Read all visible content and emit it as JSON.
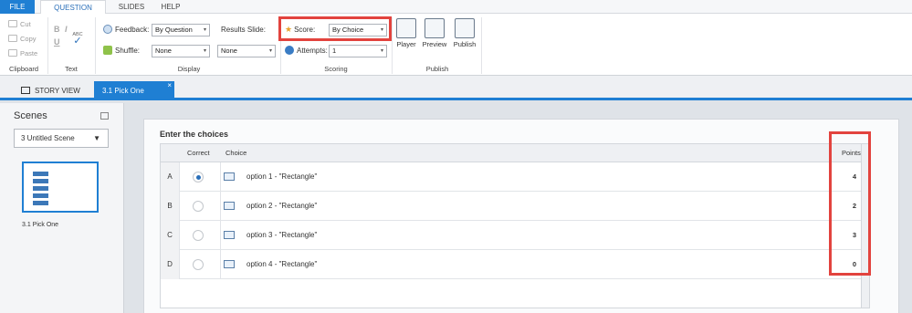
{
  "ribbon_tabs": [
    "FILE",
    "QUESTION",
    "SLIDES",
    "HELP"
  ],
  "clipboard": {
    "cut": "Cut",
    "copy": "Copy",
    "paste": "Paste",
    "group": "Clipboard"
  },
  "text_group": {
    "bold": "B",
    "italic": "I",
    "underline": "U",
    "spell": "ABC",
    "group": "Text"
  },
  "display": {
    "feedback_label": "Feedback:",
    "feedback_value": "By Question",
    "shuffle_label": "Shuffle:",
    "shuffle_value": "None",
    "results_label": "Results Slide:",
    "results_value": "None",
    "group": "Display"
  },
  "scoring": {
    "score_label": "Score:",
    "score_value": "By Choice",
    "attempts_label": "Attempts:",
    "attempts_value": "1",
    "group": "Scoring"
  },
  "publish": {
    "player": "Player",
    "preview": "Preview",
    "publish": "Publish",
    "group": "Publish"
  },
  "doc_tabs": {
    "story": "STORY VIEW",
    "active": "3.1 Pick One",
    "close": "×"
  },
  "scenes": {
    "title": "Scenes",
    "dropdown": "3 Untitled Scene",
    "thumb_label": "3.1 Pick One"
  },
  "content": {
    "title": "Enter the choices",
    "headers": {
      "correct": "Correct",
      "choice": "Choice",
      "points": "Points"
    },
    "rows": [
      {
        "letter": "A",
        "correct": true,
        "choice": "option 1 - \"Rectangle\"",
        "points": "4"
      },
      {
        "letter": "B",
        "correct": false,
        "choice": "option 2 - \"Rectangle\"",
        "points": "2"
      },
      {
        "letter": "C",
        "correct": false,
        "choice": "option 3 - \"Rectangle\"",
        "points": "3"
      },
      {
        "letter": "D",
        "correct": false,
        "choice": "option 4 - \"Rectangle\"",
        "points": "0"
      }
    ]
  },
  "colors": {
    "accent": "#1f7fd3",
    "highlight": "#e2433e"
  }
}
